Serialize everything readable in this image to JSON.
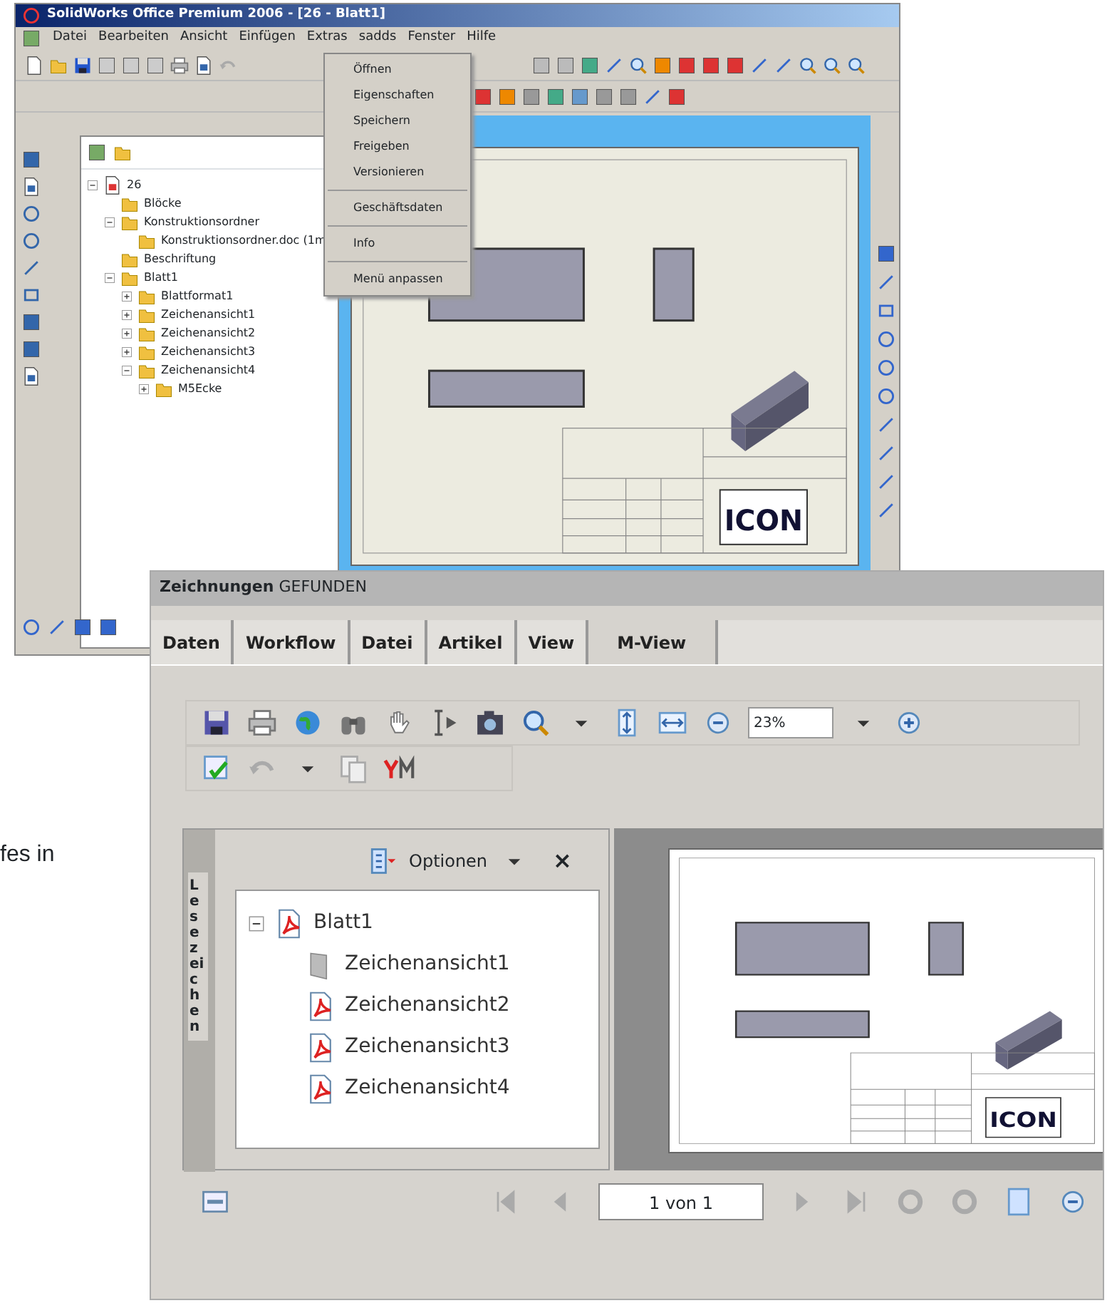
{
  "page_text": "fes in",
  "cad_window": {
    "title": "SolidWorks Office Premium 2006 - [26 - Blatt1]",
    "menu": [
      "Datei",
      "Bearbeiten",
      "Ansicht",
      "Einfügen",
      "Extras",
      "sadds",
      "Fenster",
      "Hilfe"
    ],
    "dropdown": [
      {
        "kind": "item",
        "label": "Öffnen"
      },
      {
        "kind": "item",
        "label": "Eigenschaften"
      },
      {
        "kind": "item",
        "label": "Speichern"
      },
      {
        "kind": "item",
        "label": "Freigeben"
      },
      {
        "kind": "item",
        "label": "Versionieren"
      },
      {
        "kind": "separator"
      },
      {
        "kind": "item",
        "label": "Geschäftsdaten"
      },
      {
        "kind": "separator"
      },
      {
        "kind": "item",
        "label": "Info"
      },
      {
        "kind": "separator"
      },
      {
        "kind": "item",
        "label": "Menü anpassen"
      }
    ],
    "tree": [
      {
        "label": "26",
        "expanded": true,
        "children": [
          {
            "label": "Blöcke"
          },
          {
            "label": "Konstruktionsordner",
            "expanded": true,
            "children": [
              {
                "label": "Konstruktionsordner.doc (1m"
              }
            ]
          },
          {
            "label": "Beschriftung"
          },
          {
            "label": "Blatt1",
            "expanded": true,
            "children": [
              {
                "label": "Blattformat1",
                "expanded": false
              },
              {
                "label": "Zeichenansicht1",
                "expanded": false
              },
              {
                "label": "Zeichenansicht2",
                "expanded": false
              },
              {
                "label": "Zeichenansicht3",
                "expanded": false
              },
              {
                "label": "Zeichenansicht4",
                "expanded": true,
                "children": [
                  {
                    "label": "M5Ecke",
                    "expanded": false
                  }
                ]
              }
            ]
          }
        ]
      }
    ],
    "sheet_logo": "ICON"
  },
  "viewer_window": {
    "header": "**Zeichnungen** GEFUNDEN",
    "tabs": [
      {
        "label": "Daten",
        "selected": false
      },
      {
        "label": "Workflow",
        "selected": false
      },
      {
        "label": "Datei",
        "selected": false
      },
      {
        "label": "Artikel",
        "selected": false
      },
      {
        "label": "View",
        "selected": false
      },
      {
        "label": "M-View",
        "selected": true
      }
    ],
    "zoom": "23%",
    "bookmarks": {
      "tab": "Lesezeichen",
      "options": "Optionen",
      "close": "×",
      "tree": [
        {
          "label": "Blatt1",
          "expanded": true,
          "children": [
            {
              "label": "Zeichenansicht1",
              "kind": "folder"
            },
            {
              "label": "Zeichenansicht2",
              "kind": "pdf"
            },
            {
              "label": "Zeichenansicht3",
              "kind": "pdf"
            },
            {
              "label": "Zeichenansicht4",
              "kind": "pdf"
            }
          ]
        }
      ]
    },
    "page_field": "1 von 1",
    "sheet_logo": "ICON"
  }
}
